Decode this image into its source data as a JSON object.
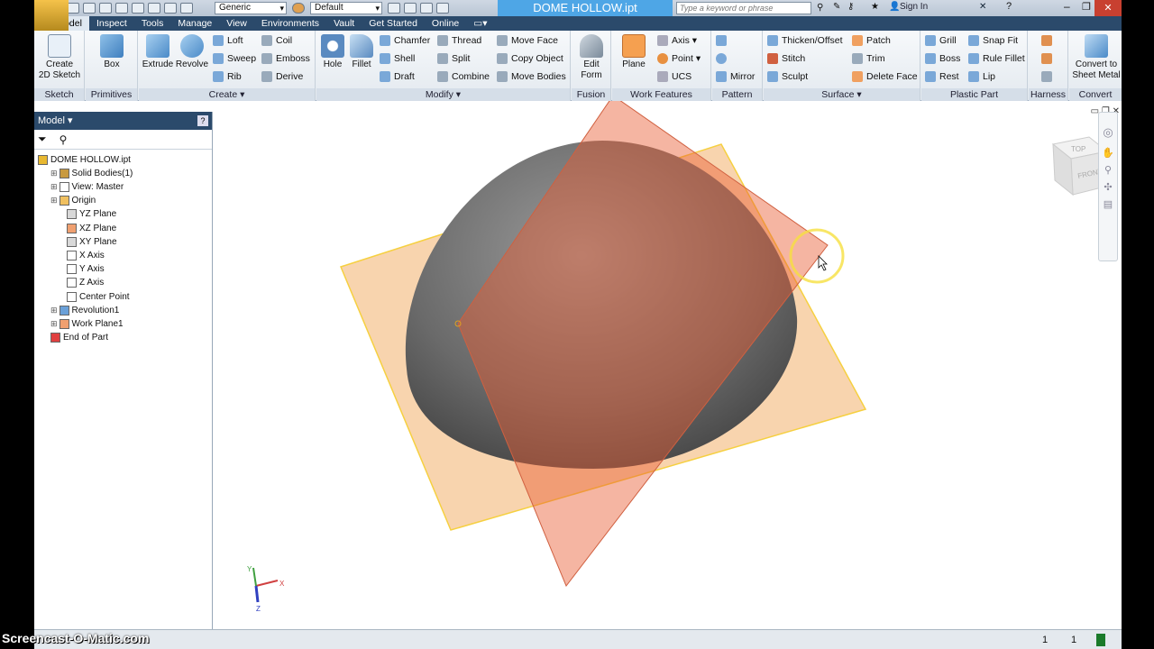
{
  "app": {
    "title": "DOME HOLLOW.ipt",
    "search_placeholder": "Type a keyword or phrase",
    "sign_in": "Sign In",
    "style_combo": "Generic",
    "appearance_combo": "Default"
  },
  "tabs": [
    "3D Model",
    "Inspect",
    "Tools",
    "Manage",
    "View",
    "Environments",
    "Vault",
    "Get Started",
    "Online"
  ],
  "ribbon": {
    "sketch": {
      "label": "Sketch",
      "create_2d": "Create\n2D Sketch"
    },
    "primitives": {
      "label": "Primitives",
      "box": "Box"
    },
    "create": {
      "label": "Create",
      "extrude": "Extrude",
      "revolve": "Revolve",
      "loft": "Loft",
      "sweep": "Sweep",
      "rib": "Rib",
      "coil": "Coil",
      "emboss": "Emboss",
      "derive": "Derive"
    },
    "modify": {
      "label": "Modify",
      "hole": "Hole",
      "fillet": "Fillet",
      "chamfer": "Chamfer",
      "shell": "Shell",
      "draft": "Draft",
      "thread": "Thread",
      "split": "Split",
      "combine": "Combine",
      "move_face": "Move Face",
      "copy_object": "Copy Object",
      "move_bodies": "Move Bodies"
    },
    "fusion": {
      "label": "Fusion",
      "edit_form": "Edit\nForm"
    },
    "work_features": {
      "label": "Work Features",
      "plane": "Plane",
      "axis": "Axis",
      "point": "Point",
      "ucs": "UCS"
    },
    "pattern": {
      "label": "Pattern",
      "mirror": "Mirror"
    },
    "surface": {
      "label": "Surface",
      "thicken": "Thicken/Offset",
      "stitch": "Stitch",
      "sculpt": "Sculpt",
      "patch": "Patch",
      "trim": "Trim",
      "delete_face": "Delete Face"
    },
    "plastic": {
      "label": "Plastic Part",
      "grill": "Grill",
      "boss": "Boss",
      "rest": "Rest",
      "snap_fit": "Snap Fit",
      "rule_fillet": "Rule Fillet",
      "lip": "Lip"
    },
    "harness": {
      "label": "Harness"
    },
    "convert": {
      "label": "Convert",
      "sheet_metal": "Convert to\nSheet Metal"
    }
  },
  "browser": {
    "title": "Model",
    "nodes": [
      {
        "label": "DOME HOLLOW.ipt",
        "color": "#e8b830"
      },
      {
        "label": "Solid Bodies(1)",
        "color": "#c89a40"
      },
      {
        "label": "View: Master",
        "color": "#ffffff"
      },
      {
        "label": "Origin",
        "color": "#f0c060"
      },
      {
        "label": "YZ Plane",
        "color": "#d8d8d8"
      },
      {
        "label": "XZ Plane",
        "color": "#f0a070"
      },
      {
        "label": "XY Plane",
        "color": "#d8d8d8"
      },
      {
        "label": "X Axis",
        "color": "#ffffff"
      },
      {
        "label": "Y Axis",
        "color": "#ffffff"
      },
      {
        "label": "Z Axis",
        "color": "#ffffff"
      },
      {
        "label": "Center Point",
        "color": "#ffffff"
      },
      {
        "label": "Revolution1",
        "color": "#6aa0d8"
      },
      {
        "label": "Work Plane1",
        "color": "#f0a070"
      },
      {
        "label": "End of Part",
        "color": "#e04040"
      }
    ]
  },
  "viewcube": {
    "top": "TOP",
    "front": "FRONT"
  },
  "triad": {
    "x": "X",
    "y": "Y",
    "z": "Z"
  },
  "status": {
    "count1": "1",
    "count2": "1"
  },
  "watermark": "Screencast-O-Matic.com"
}
